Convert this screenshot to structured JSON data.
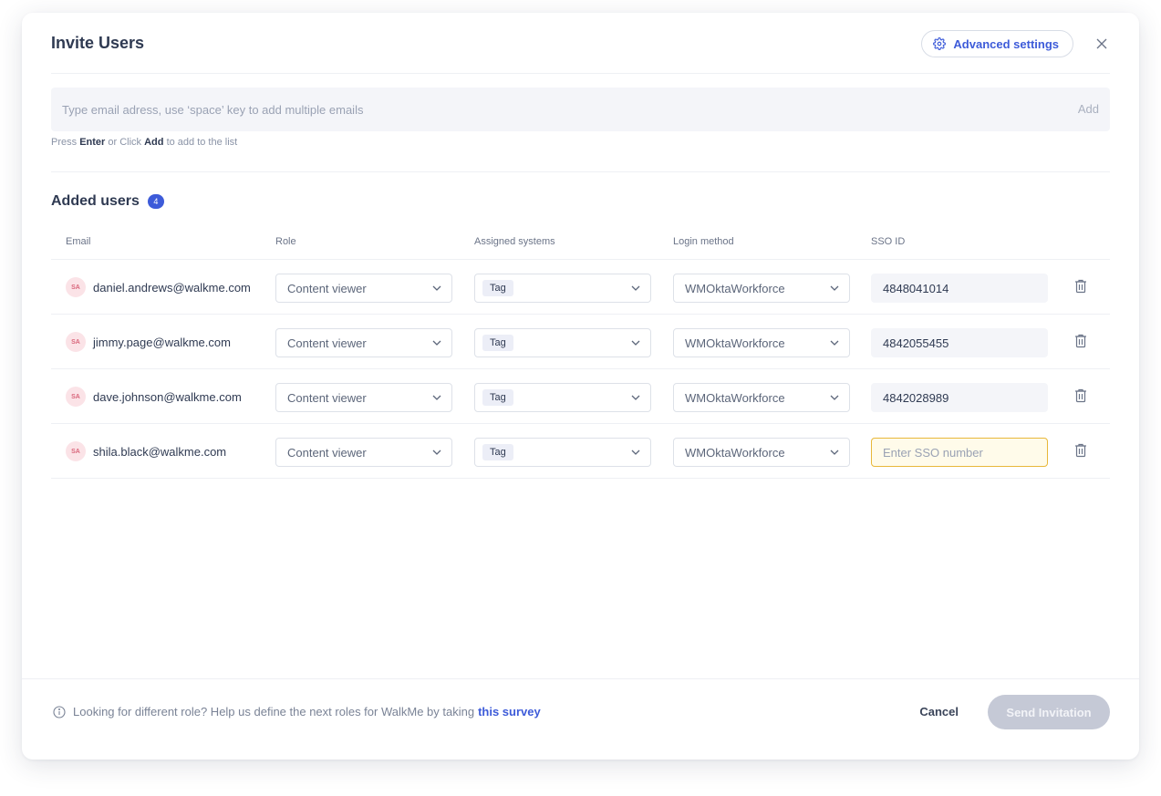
{
  "header": {
    "title": "Invite Users",
    "advanced_settings_label": "Advanced settings"
  },
  "email_input": {
    "placeholder": "Type email adress, use ‘space’ key to add multiple emails",
    "add_label": "Add"
  },
  "hint": {
    "prefix": "Press",
    "key1": "Enter",
    "middle": "or Click",
    "key2": "Add",
    "suffix": "to add to the list"
  },
  "added_users": {
    "title": "Added users",
    "count": "4"
  },
  "columns": {
    "email": "Email",
    "role": "Role",
    "systems": "Assigned systems",
    "login": "Login method",
    "sso": "SSO ID"
  },
  "users": [
    {
      "initials": "SA",
      "email": "daniel.andrews@walkme.com",
      "role": "Content viewer",
      "system_tag": "Tag",
      "login": "WMOktaWorkforce",
      "sso": "4848041014"
    },
    {
      "initials": "SA",
      "email": "jimmy.page@walkme.com",
      "role": "Content viewer",
      "system_tag": "Tag",
      "login": "WMOktaWorkforce",
      "sso": "4842055455"
    },
    {
      "initials": "SA",
      "email": "dave.johnson@walkme.com",
      "role": "Content viewer",
      "system_tag": "Tag",
      "login": "WMOktaWorkforce",
      "sso": "4842028989"
    },
    {
      "initials": "SA",
      "email": "shila.black@walkme.com",
      "role": "Content viewer",
      "system_tag": "Tag",
      "login": "WMOktaWorkforce",
      "sso": ""
    }
  ],
  "sso_placeholder": "Enter SSO number",
  "footer": {
    "info_text": "Looking for different role? Help us define the next roles for WalkMe by taking",
    "survey_link": "this survey",
    "cancel_label": "Cancel",
    "send_label": "Send Invitation"
  },
  "colors": {
    "accent": "#3d5bd9",
    "text": "#2f3a52",
    "disabled_button": "#c5c9d6",
    "warning_border": "#e8b83a"
  }
}
